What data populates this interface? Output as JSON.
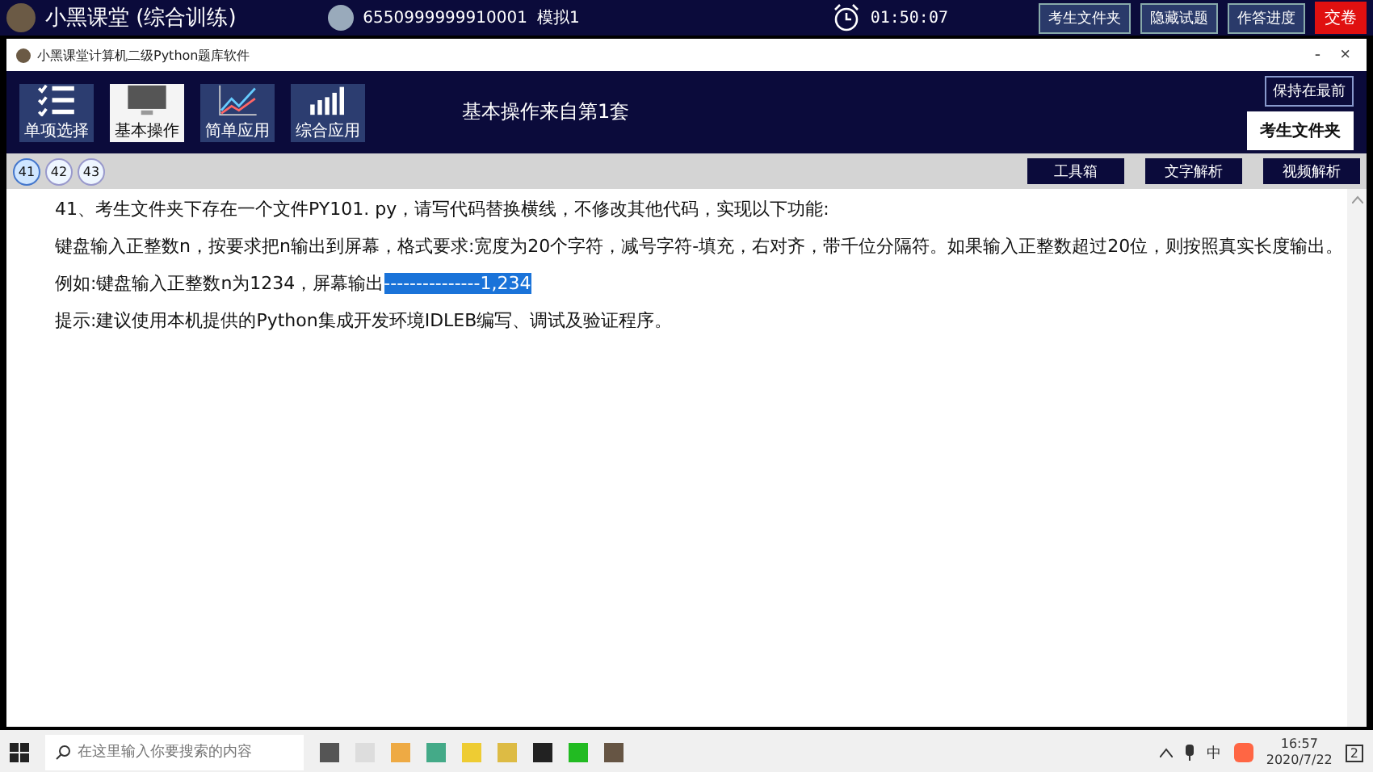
{
  "top_bar": {
    "title": "小黑课堂 (综合训练)",
    "user_id": "6550999999910001",
    "mode": "模拟1",
    "timer": "01:50:07",
    "buttons": [
      {
        "label": "考生文件夹",
        "kind": "normal"
      },
      {
        "label": "隐藏试题",
        "kind": "normal"
      },
      {
        "label": "作答进度",
        "kind": "normal"
      },
      {
        "label": "交卷",
        "kind": "danger"
      }
    ]
  },
  "window": {
    "title": "小黑课堂计算机二级Python题库软件",
    "minimize": "-",
    "close": "×"
  },
  "header": {
    "nav": [
      {
        "label": "单项选择",
        "kind": "checklist",
        "selected": false
      },
      {
        "label": "基本操作",
        "kind": "monitor",
        "selected": true
      },
      {
        "label": "简单应用",
        "kind": "line",
        "selected": false
      },
      {
        "label": "综合应用",
        "kind": "bars",
        "selected": false
      }
    ],
    "set_title": "基本操作来自第1套",
    "pin_button": "保持在最前",
    "folder_button": "考生文件夹"
  },
  "question_tabs": [
    {
      "label": "41",
      "selected": true
    },
    {
      "label": "42",
      "selected": false
    },
    {
      "label": "43",
      "selected": false
    }
  ],
  "tools": [
    "工具箱",
    "文字解析",
    "视频解析"
  ],
  "content": [
    {
      "text": "41、考生文件夹下存在一个文件PY101. py，请写代码替换横线，不修改其他代码，实现以下功能:"
    },
    {
      "text": "键盘输入正整数n，按要求把n输出到屏幕，格式要求:宽度为20个字符，减号字符-填充，右对齐，带千位分隔符。如果输入正整数超过20位，则按照真实长度输出。"
    },
    {
      "text": "例如:键盘输入正整数n为1234，屏幕输出",
      "highlight": "---------------1,234"
    },
    {
      "text": "提示:建议使用本机提供的Python集成开发环境IDLEB编写、调试及验证程序。"
    }
  ],
  "taskbar": {
    "search_placeholder": "在这里输入你要搜索的内容",
    "ime": "中",
    "time": "16:57",
    "date": "2020/7/22",
    "notifications": "2"
  }
}
